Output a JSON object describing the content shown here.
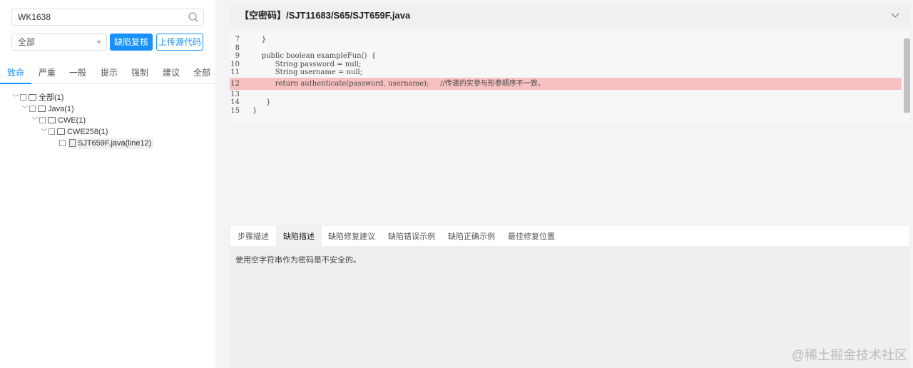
{
  "left": {
    "search": {
      "value": "WK1638"
    },
    "filter_select": "全部",
    "review_button": "缺陷复核",
    "upload_button": "上传源代码",
    "tabs": [
      "致命",
      "严重",
      "一般",
      "提示",
      "强制",
      "建议",
      "全部"
    ],
    "active_tab": "致命",
    "tree": {
      "root": "全部(1)",
      "java": "Java(1)",
      "cwe": "CWE(1)",
      "cwe258": "CWE258(1)",
      "leaf": "SJT659F.java(line12)"
    }
  },
  "header": {
    "title": "【空密码】/SJT11683/S65/SJT659F.java"
  },
  "code": {
    "lines": [
      {
        "n": "7",
        "t": "    }"
      },
      {
        "n": "8",
        "t": ""
      },
      {
        "n": "9",
        "t": "    public boolean exampleFun()  {"
      },
      {
        "n": "10",
        "t": "          String password = null;"
      },
      {
        "n": "11",
        "t": "          String username = null;"
      },
      {
        "n": "12",
        "t": "          return authenticate(password, username);     //传递的实参与形参顺序不一致。"
      },
      {
        "n": "13",
        "t": ""
      },
      {
        "n": "14",
        "t": "      }"
      },
      {
        "n": "15",
        "t": "}"
      }
    ],
    "highlight_line": "12",
    "highlight_color": "#f8c1c1"
  },
  "detail": {
    "tabs": [
      "步骤描述",
      "缺陷描述",
      "缺陷修复建议",
      "缺陷错误示例",
      "缺陷正确示例",
      "最佳修复位置"
    ],
    "active_tab": "缺陷描述",
    "text": "使用空字符串作为密码是不安全的。"
  },
  "watermark": "@稀土掘金技术社区",
  "colors": {
    "accent": "#1890ff"
  }
}
